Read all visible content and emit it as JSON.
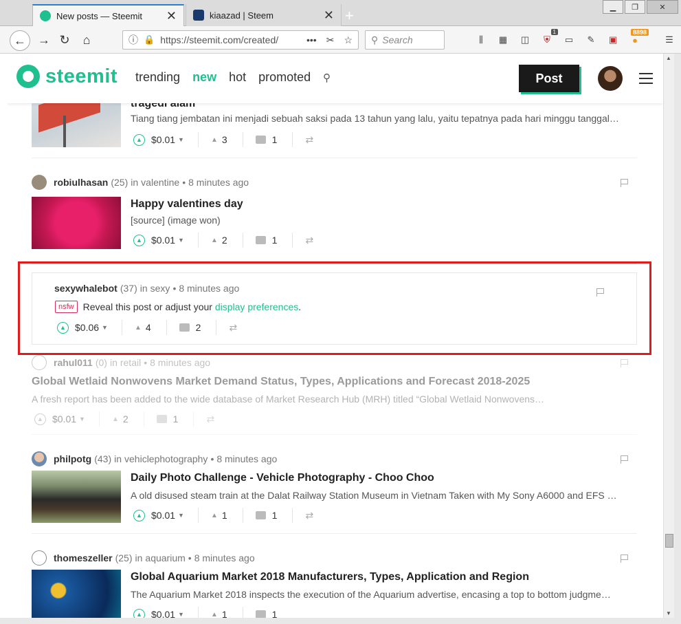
{
  "browser": {
    "tabs": [
      {
        "title": "New posts — Steemit",
        "active": true
      },
      {
        "title": "kiaazad | Steem",
        "active": false
      }
    ],
    "url": "https://steemit.com/created/",
    "search_placeholder": "Search",
    "ext_badge_1": "1",
    "ext_badge_2": "8898"
  },
  "site": {
    "logo_text": "steemit",
    "nav": [
      "trending",
      "new",
      "hot",
      "promoted"
    ],
    "post_button": "Post",
    "brand_color": "#1fbf8f"
  },
  "posts": [
    {
      "title": "tragedi alam",
      "snippet": "Tiang tiang jembatan ini menjadi sebuah saksi pada 13 tahun yang lalu, yaitu tepatnya pada hari minggu tanggal…",
      "payout": "$0.01",
      "votes": "3",
      "comments": "1"
    },
    {
      "author": "robiulhasan",
      "rep": "(25)",
      "category": "valentine",
      "time": "8 minutes ago",
      "title": "Happy valentines day",
      "snippet": "[source] (image won)",
      "payout": "$0.01",
      "votes": "2",
      "comments": "1"
    },
    {
      "author": "sexywhalebot",
      "rep": "(37)",
      "category": "sexy",
      "time": "8 minutes ago",
      "tag": "nsfw",
      "notice": "Reveal this post or adjust your",
      "notice_link": "display preferences",
      "notice_end": ".",
      "payout": "$0.06",
      "votes": "4",
      "comments": "2"
    },
    {
      "author": "rahul011",
      "rep": "(0)",
      "category": "retail",
      "time": "8 minutes ago",
      "title": "Global Wetlaid Nonwovens Market Demand Status, Types, Applications and Forecast 2018-2025",
      "snippet": "A fresh report has been added to the wide database of Market Research Hub (MRH) titled “Global Wetlaid Nonwovens…",
      "payout": "$0.01",
      "votes": "2",
      "comments": "1"
    },
    {
      "author": "philpotg",
      "rep": "(43)",
      "category": "vehiclephotography",
      "time": "8 minutes ago",
      "title": "Daily Photo Challenge - Vehicle Photography - Choo Choo",
      "snippet": "A old disused steam train at the Dalat Railway Station Museum in Vietnam Taken with My Sony A6000 and EFS …",
      "payout": "$0.01",
      "votes": "1",
      "comments": "1"
    },
    {
      "author": "thomeszeller",
      "rep": "(25)",
      "category": "aquarium",
      "time": "8 minutes ago",
      "title": "Global Aquarium Market 2018 Manufacturers, Types, Application and Region",
      "snippet": "The Aquarium Market 2018 inspects the execution of the Aquarium advertise, encasing a top to bottom judgme…",
      "payout": "$0.01",
      "votes": "1",
      "comments": "1"
    }
  ],
  "labels": {
    "in": "in",
    "dot": "•"
  }
}
